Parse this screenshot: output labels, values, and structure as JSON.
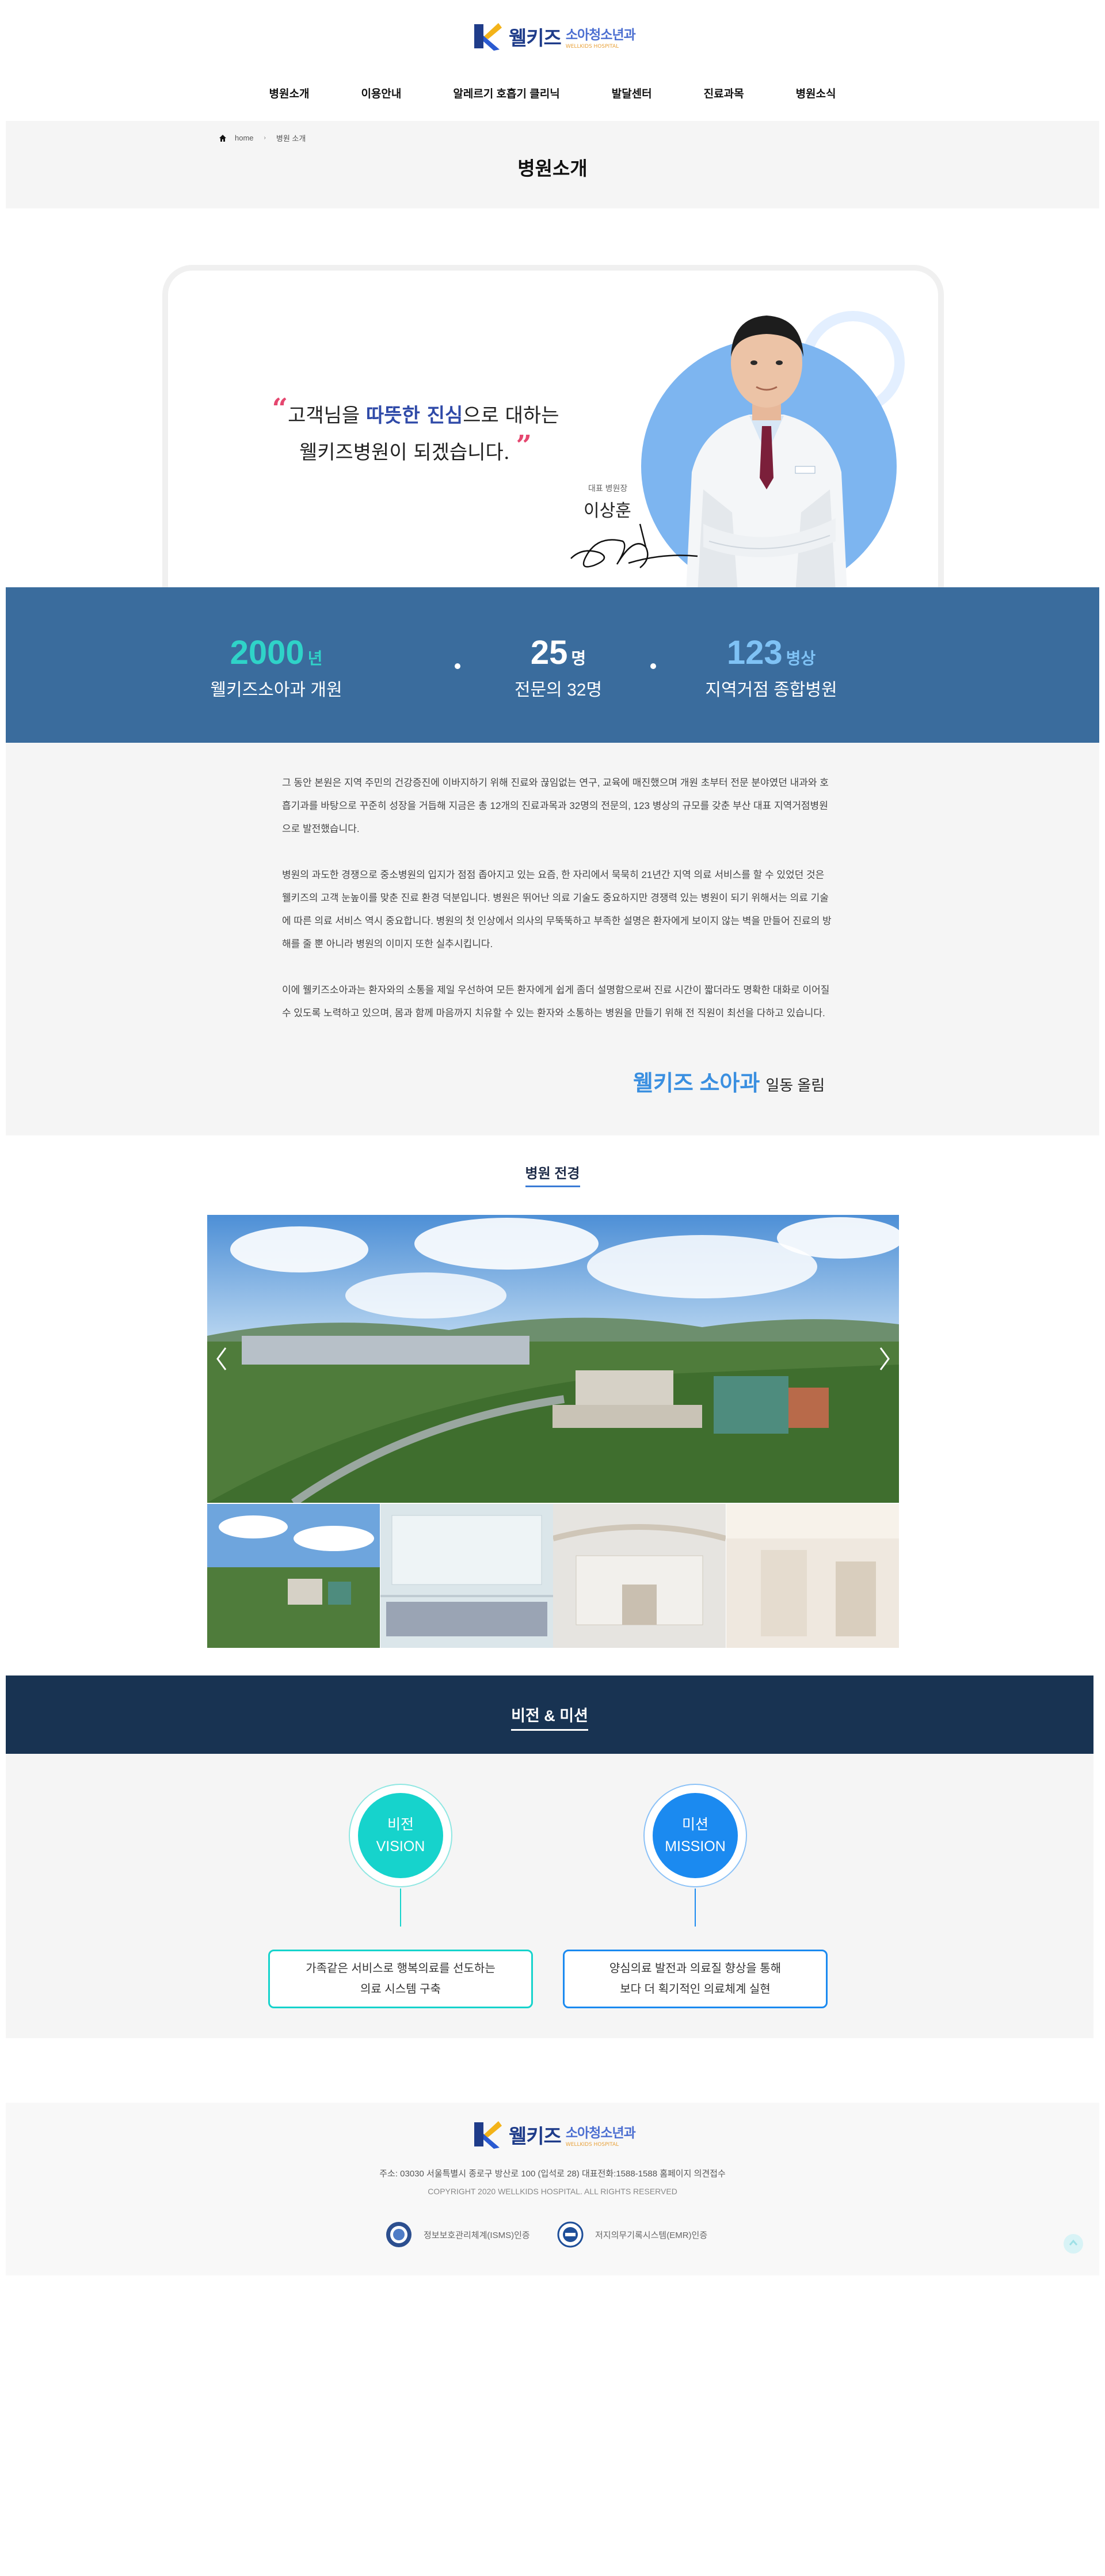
{
  "header": {
    "logo": {
      "brand": "웰키즈",
      "sub": "소아청소년과",
      "tagline": "WELLKIDS HOSPITAL"
    },
    "nav": [
      "병원소개",
      "이용안내",
      "알레르기 호흡기 클리닉",
      "발달센터",
      "진료과목",
      "병원소식"
    ]
  },
  "subhead": {
    "breadcrumb": {
      "home": "home",
      "current": "병원 소개"
    },
    "title": "병원소개"
  },
  "greeting": {
    "open_quote": "“",
    "line1_pre": "고객님을 ",
    "line1_hl": "따뜻한 진심",
    "line1_post": "으로 대하는",
    "line2": "웰키즈병원이 되겠습니다.",
    "close_quote": "”",
    "role": "대표 병원장",
    "name": "이상훈"
  },
  "stats": [
    {
      "num": "2000",
      "unit": "년",
      "label": "웰키즈소아과 개원",
      "color": "#2fd3c8"
    },
    {
      "num": "25",
      "unit": "명",
      "label": "전문의 32명",
      "color": "#ffffff"
    },
    {
      "num": "123",
      "unit": "병상",
      "label": "지역거점 종합병원",
      "color": "#7fc2f5"
    }
  ],
  "intro": {
    "p1": " 그 동안 본원은 지역 주민의 건강증진에 이바지하기 위해 진료와 끊임없는 연구, 교육에 매진했으며 개원 초부터 전문 분야였던 내과와 호흡기과를 바탕으로 꾸준히 성장을 거듭해 지금은 총 12개의 진료과목과 32명의 전문의, 123 병상의 규모를 갖춘 부산 대표 지역거점병원으로 발전했습니다.",
    "p2": " 병원의 과도한 경쟁으로 중소병원의 입지가 점점 좁아지고 있는 요즘, 한 자리에서 묵묵히 21년간 지역 의료 서비스를 할 수 있었던 것은 웰키즈의 고객 눈높이를 맞춘 진료 환경 덕분입니다. 병원은 뛰어난 의료 기술도 중요하지만 경쟁력 있는 병원이 되기 위해서는 의료 기술에 따른 의료 서비스 역시 중요합니다. 병원의 첫 인상에서 의사의 무뚝뚝하고 부족한 설명은 환자에게 보이지 않는 벽을 만들어 진료의 방해를 줄 뿐 아니라 병원의 이미지 또한 실추시킵니다.",
    "p3": "이에 웰키즈소아과는 환자와의 소통을 제일 우선하여 모든 환자에게 쉽게 좀더 설명함으로써 진료 시간이 짧더라도 명확한 대화로 이어질 수 있도록 노력하고 있으며, 몸과 함께 마음까지 치유할 수 있는 환자와 소통하는 병원을 만들기 위해 전 직원이 최선을 다하고 있습니다.",
    "closing_brand": "웰키즈 소아과",
    "closing_tail": "일동 올림"
  },
  "gallery": {
    "title": "병원 전경"
  },
  "vision_mission": {
    "title": "비전 & 미션",
    "vision": {
      "ko": "비전",
      "en": "VISION",
      "text1": "가족같은 서비스로 행복의료를 선도하는",
      "text2": "의료 시스템 구축",
      "color": "#16d3cc"
    },
    "mission": {
      "ko": "미션",
      "en": "MISSION",
      "text1": "양심의료 발전과 의료질 향상을 통해",
      "text2": "보다 더 획기적인 의료체계 실현",
      "color": "#1b8af0"
    }
  },
  "footer": {
    "address": "주소: 03030 서울특별시 종로구 방산로 100 (입석로 28) 대표전화:1588-1588 홈페이지 의견접수",
    "copyright": "COPYRIGHT 2020 WELLKIDS HOSPITAL. ALL RIGHTS RESERVED",
    "cert1": "정보보호관리체계(ISMS)인증",
    "cert2": "저지의무기록시스템(EMR)인증"
  }
}
